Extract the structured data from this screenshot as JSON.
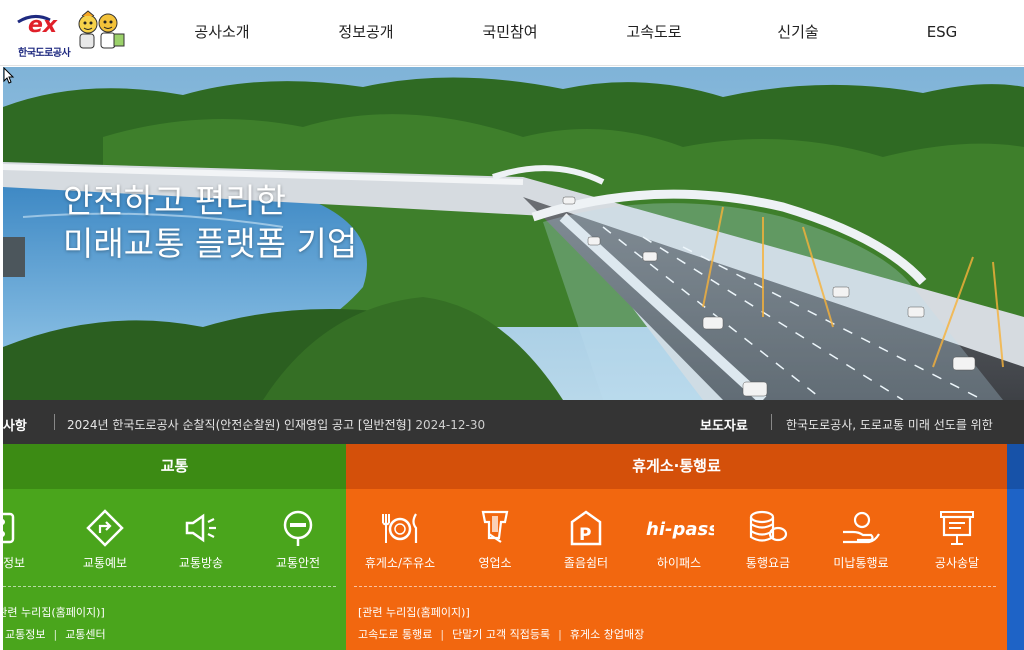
{
  "brand": {
    "logo_text": "한국도로공사",
    "logo_mark": "ex"
  },
  "nav": {
    "items": [
      "공사소개",
      "정보공개",
      "국민참여",
      "고속도로",
      "신기술",
      "ESG"
    ]
  },
  "hero": {
    "line1": "안전하고 편리한",
    "line2": "미래교통 플랫폼 기업"
  },
  "notice": {
    "label": "공지사항",
    "text": "2024년 한국도로공사 순찰직(안전순찰원) 인재영입 공고 [일반전형]",
    "date": "2024-12-30",
    "press_label": "보도자료",
    "press_text": "한국도로공사, 도로교통 미래 선도를 위한"
  },
  "traffic": {
    "title": "교통",
    "items": [
      {
        "label": "교통정보",
        "icon": "traffic-light-icon"
      },
      {
        "label": "교통예보",
        "icon": "direction-sign-icon"
      },
      {
        "label": "교통방송",
        "icon": "megaphone-icon"
      },
      {
        "label": "교통안전",
        "icon": "no-entry-sign-icon"
      }
    ],
    "related_title": "[관련 누리집(홈페이지)]",
    "links": [
      "고속도로 교통정보",
      "교통센터"
    ]
  },
  "rest": {
    "title": "휴게소·통행료",
    "items": [
      {
        "label": "휴게소/주유소",
        "icon": "dining-icon"
      },
      {
        "label": "영업소",
        "icon": "toll-booth-icon"
      },
      {
        "label": "졸음쉼터",
        "icon": "parking-icon"
      },
      {
        "label": "하이패스",
        "icon": "hipass-logo-icon"
      },
      {
        "label": "통행요금",
        "icon": "coins-icon"
      },
      {
        "label": "미납통행료",
        "icon": "payment-hand-icon"
      },
      {
        "label": "공사송달",
        "icon": "notice-board-icon"
      }
    ],
    "hipass_text": "hi-pass",
    "related_title": "[관련 누리집(홈페이지)]",
    "links": [
      "고속도로 통행료",
      "단말기 고객 직접등록",
      "휴게소 창업매장"
    ]
  },
  "colors": {
    "green": "#4aa51c",
    "orange": "#f2670f",
    "blue": "#1e63c6",
    "logo_red": "#e0202a",
    "logo_navy": "#1f2a80"
  }
}
